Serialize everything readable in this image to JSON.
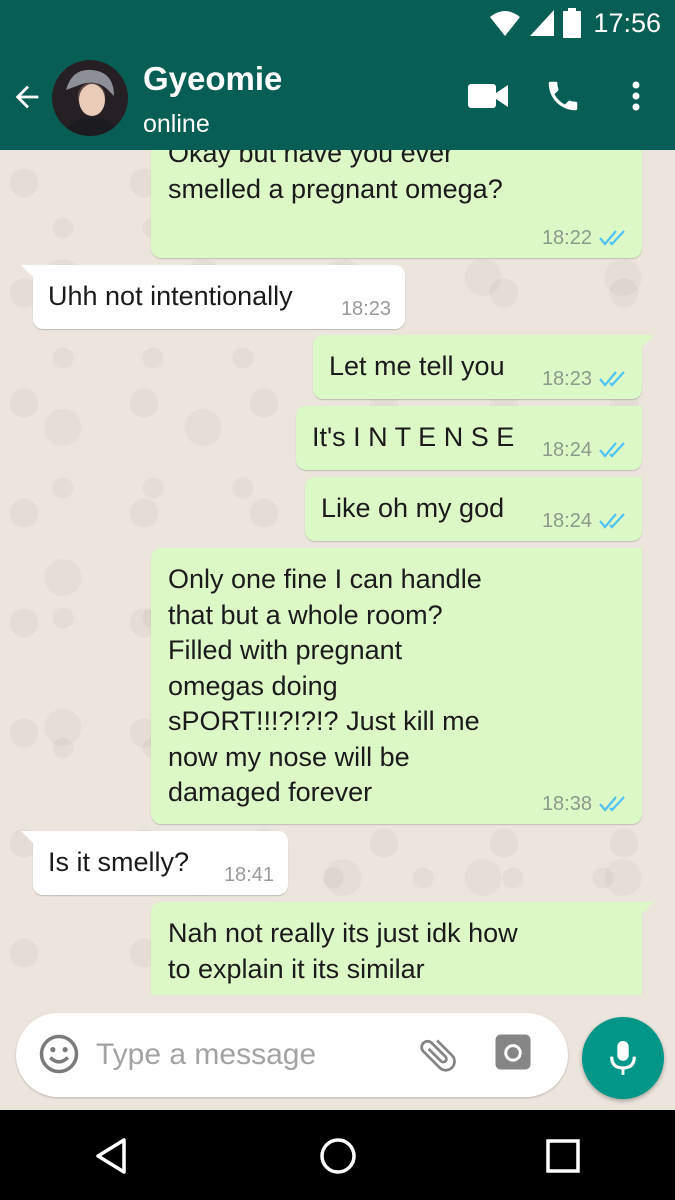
{
  "status_bar": {
    "time": "17:56",
    "icons": [
      "wifi-icon",
      "cell-signal-icon",
      "battery-icon"
    ]
  },
  "header": {
    "back_icon": "arrow-left-icon",
    "contact_name": "Gyeomie",
    "contact_status": "online",
    "actions": [
      "video-call-icon",
      "phone-icon",
      "more-vert-icon"
    ]
  },
  "messages": [
    {
      "direction": "out",
      "text": "Okay but have you ever smelled a pregnant omega?",
      "time": "18:22",
      "read": true
    },
    {
      "direction": "in",
      "text": "Uhh not intentionally",
      "time": "18:23"
    },
    {
      "direction": "out",
      "text": "Let me tell you",
      "time": "18:23",
      "read": true
    },
    {
      "direction": "out",
      "text": "It's I N T E N S E",
      "time": "18:24",
      "read": true
    },
    {
      "direction": "out",
      "text": "Like oh my god",
      "time": "18:24",
      "read": true
    },
    {
      "direction": "out",
      "text": "Only one fine I can handle that but a whole room? Filled with pregnant omegas doing sPORT!!!?!?!? Just kill me now my nose will be damaged forever",
      "time": "18:38",
      "read": true
    },
    {
      "direction": "in",
      "text": "Is it smelly?",
      "time": "18:41"
    },
    {
      "direction": "out",
      "text": "Nah not really its just idk how to explain it its similar",
      "time": "",
      "read": true
    }
  ],
  "input": {
    "placeholder": "Type a message",
    "icons": [
      "emoji-icon",
      "attach-icon",
      "camera-icon",
      "mic-icon"
    ]
  },
  "colors": {
    "header": "#075e54",
    "outgoing_bubble": "#dcf8c6",
    "incoming_bubble": "#ffffff",
    "read_ticks": "#4fc3f7",
    "mic_button": "#009688",
    "chat_background": "#ece5dd"
  },
  "nav_bar": {
    "icons": [
      "back-triangle-icon",
      "home-circle-icon",
      "recents-square-icon"
    ]
  }
}
